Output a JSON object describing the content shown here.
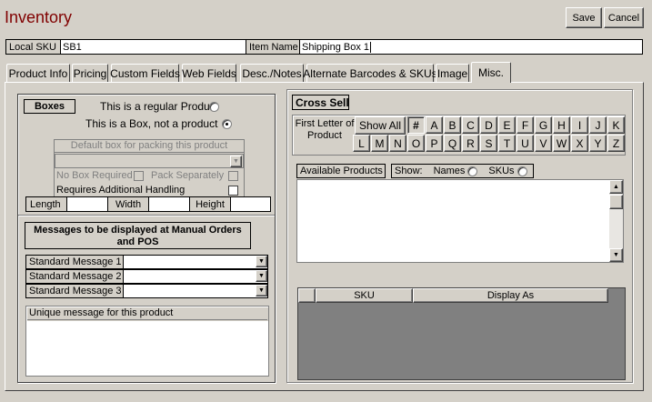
{
  "window": {
    "title": "Inventory"
  },
  "actions": {
    "save": "Save",
    "cancel": "Cancel"
  },
  "sku_row": {
    "local_sku_label": "Local SKU",
    "local_sku_value": "SB1",
    "item_name_label": "Item Name",
    "item_name_value": "Shipping Box 1"
  },
  "tabs": [
    {
      "label": "Product Info"
    },
    {
      "label": "Pricing"
    },
    {
      "label": "Custom Fields"
    },
    {
      "label": "Web Fields"
    },
    {
      "label": "Desc./Notes"
    },
    {
      "label": "Alternate Barcodes & SKUs"
    },
    {
      "label": "Image"
    },
    {
      "label": "Misc.",
      "active": true
    }
  ],
  "boxes": {
    "heading": "Boxes",
    "regular_product": "This is a regular Product",
    "box_not_product": "This is a Box, not a product",
    "selected": "box",
    "default_box_label": "Default box for packing this product",
    "default_box_value": "",
    "no_box_required": "No Box Required",
    "pack_separately": "Pack Separately",
    "requires_handling": "Requires Additional Handling",
    "length_label": "Length",
    "width_label": "Width",
    "height_label": "Height"
  },
  "messages": {
    "heading": "Messages to be displayed at Manual Orders and POS",
    "std1": "Standard Message 1",
    "std2": "Standard Message 2",
    "std3": "Standard Message 3",
    "unique_label": "Unique message for this product"
  },
  "cross_sell": {
    "heading": "Cross Sell",
    "first_letter": "First Letter of Product",
    "show_all": "Show All",
    "letters_row1": [
      "#",
      "A",
      "B",
      "C",
      "D",
      "E",
      "F",
      "G",
      "H",
      "I",
      "J",
      "K"
    ],
    "letters_row2": [
      "L",
      "M",
      "N",
      "O",
      "P",
      "Q",
      "R",
      "S",
      "T",
      "U",
      "V",
      "W",
      "X",
      "Y",
      "Z"
    ],
    "selected_letter": "#",
    "available_products": "Available Products",
    "show_label": "Show:",
    "names": "Names",
    "skus": "SKUs",
    "grid_headers": [
      "SKU",
      "Display As"
    ]
  },
  "colors": {
    "title": "#800000",
    "face": "#d4d0c8",
    "grid_bg": "#808080"
  }
}
